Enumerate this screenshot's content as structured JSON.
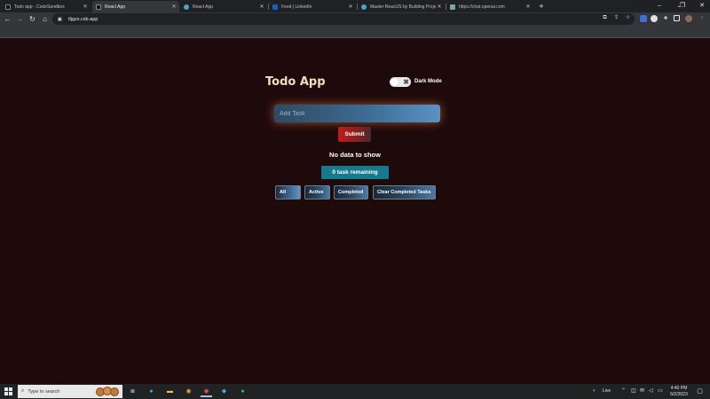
{
  "browser": {
    "tabs": [
      {
        "title": "Todo app - CodeSandbox",
        "favicon_color": "#111111",
        "active": false
      },
      {
        "title": "React App",
        "favicon_color": "#111111",
        "active": true
      },
      {
        "title": "React App",
        "favicon_color": "#4aa3c8",
        "active": false
      },
      {
        "title": "Feed | LinkedIn",
        "favicon_color": "#0a66c2",
        "active": false
      },
      {
        "title": "Master ReactJS by Building Proje",
        "favicon_color": "#4aa3c8",
        "active": false
      },
      {
        "title": "https://chat.openai.com",
        "favicon_color": "#74aa9c",
        "active": false
      }
    ],
    "new_tab_icon": "+",
    "url": "tljgzs.csb.app",
    "window_controls": {
      "minimize": "–",
      "restore": "❐",
      "close": "✕"
    }
  },
  "app": {
    "title": "Todo App",
    "dark_mode_label": "Dark Mode",
    "dark_mode_on": false,
    "toggle_glyph": "✖",
    "input_placeholder": "Add Task",
    "submit_label": "Submit",
    "empty_message": "No data to show",
    "remaining_label": "0 task remaining",
    "filters": [
      {
        "label": "All",
        "active": true
      },
      {
        "label": "Active",
        "active": false
      },
      {
        "label": "Completed",
        "active": false
      },
      {
        "label": "Clear Completed Tasks",
        "active": false
      }
    ],
    "colors": {
      "background": "#1f0a0b",
      "title": "#f3dcc0",
      "submit": "#c21b1b",
      "remaining_badge": "#157a8d"
    }
  },
  "taskbar": {
    "search_placeholder": "Type to search",
    "weather_label": "Live",
    "clock_time": "4:40 PM",
    "clock_date": "6/2/2023"
  }
}
